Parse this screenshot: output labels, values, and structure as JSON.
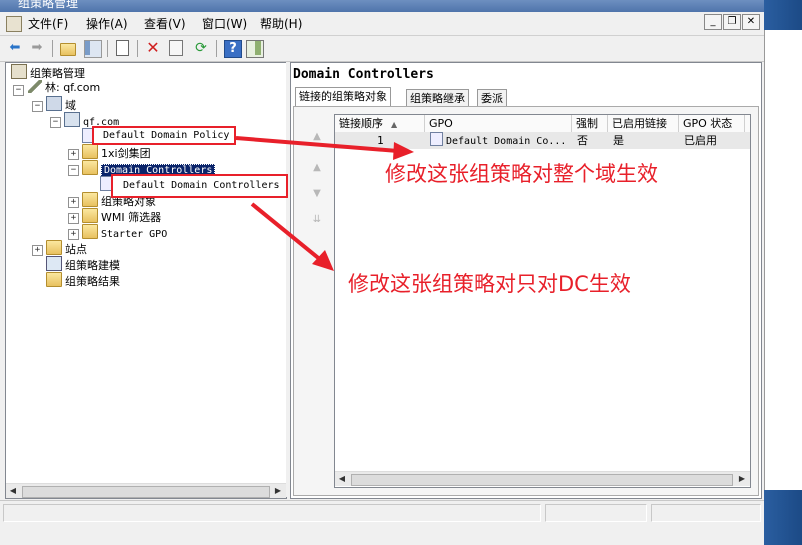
{
  "window": {
    "title": "组策略管理"
  },
  "menu": {
    "file": "文件(F)",
    "action": "操作(A)",
    "view": "查看(V)",
    "window": "窗口(W)",
    "help": "帮助(H)"
  },
  "mdi": {
    "minimize": "_",
    "restore": "❐",
    "close": "✕"
  },
  "tree": {
    "root": "组策略管理",
    "forest": "林: qf.com",
    "domains": "域",
    "domain": "qf.com",
    "default_domain_policy": "Default Domain Policy",
    "ou_1xi": "1xi剑集团",
    "domain_controllers": "Domain Controllers",
    "default_dc_policy": "Default Domain Controllers",
    "gpo_objects": "组策略对象",
    "wmi_filters": "WMI 筛选器",
    "starter_gpo": "Starter GPO",
    "sites": "站点",
    "modeling": "组策略建模",
    "results": "组策略结果"
  },
  "right": {
    "title": "Domain Controllers",
    "tabs": [
      "链接的组策略对象",
      "组策略继承",
      "委派"
    ],
    "columns": [
      "链接顺序",
      "GPO",
      "强制",
      "已启用链接",
      "GPO 状态"
    ],
    "rows": [
      {
        "order": "1",
        "gpo": "Default Domain Co...",
        "enforced": "否",
        "link_enabled": "是",
        "status": "已启用"
      }
    ]
  },
  "annotations": {
    "domain_wide": "修改这张组策略对整个域生效",
    "dc_only": "修改这张组策略对只对DC生效"
  },
  "colors": {
    "annotation": "#e8202a",
    "selection": "#0a246a"
  }
}
